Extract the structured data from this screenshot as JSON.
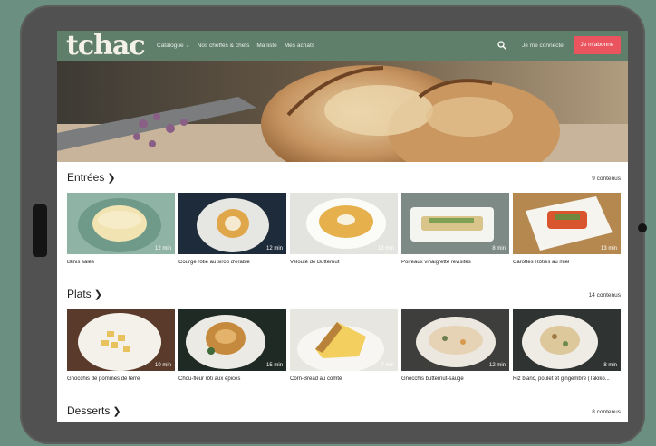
{
  "header": {
    "logo": "tchac",
    "nav": [
      {
        "label": "Catalogue",
        "has_dropdown": true
      },
      {
        "label": "Nos cheffes & chefs"
      },
      {
        "label": "Ma liste"
      },
      {
        "label": "Mes achats"
      }
    ],
    "search_icon": "search-icon",
    "login_label": "Je me connecte",
    "subscribe_label": "Je m'abonne",
    "colors": {
      "header_bg": "#5f7f6b",
      "accent": "#e9545e"
    }
  },
  "sections": [
    {
      "title": "Entrées",
      "count": "9 contenus",
      "items": [
        {
          "caption": "Blinis salés",
          "duration": "12 min"
        },
        {
          "caption": "Courge rôtie au sirop d'érable",
          "duration": "12 min"
        },
        {
          "caption": "Velouté de Butternut",
          "duration": "13 min"
        },
        {
          "caption": "Poireaux vinaigrette revisités",
          "duration": "8 min"
        },
        {
          "caption": "Carottes Rôties au miel",
          "duration": "13 min"
        }
      ]
    },
    {
      "title": "Plats",
      "count": "14 contenus",
      "items": [
        {
          "caption": "Gnocchis de pommes de terre",
          "duration": "10 min"
        },
        {
          "caption": "Chou-fleur rôti aux épices",
          "duration": "15 min"
        },
        {
          "caption": "Corn-Bread au comté",
          "duration": "7 min"
        },
        {
          "caption": "Gnocchis butternut-sauge",
          "duration": "12 min"
        },
        {
          "caption": "Riz blanc, poulet et gingembre (Takiko...",
          "duration": "8 min"
        }
      ]
    },
    {
      "title": "Desserts",
      "count": "8 contenus",
      "items": []
    }
  ]
}
